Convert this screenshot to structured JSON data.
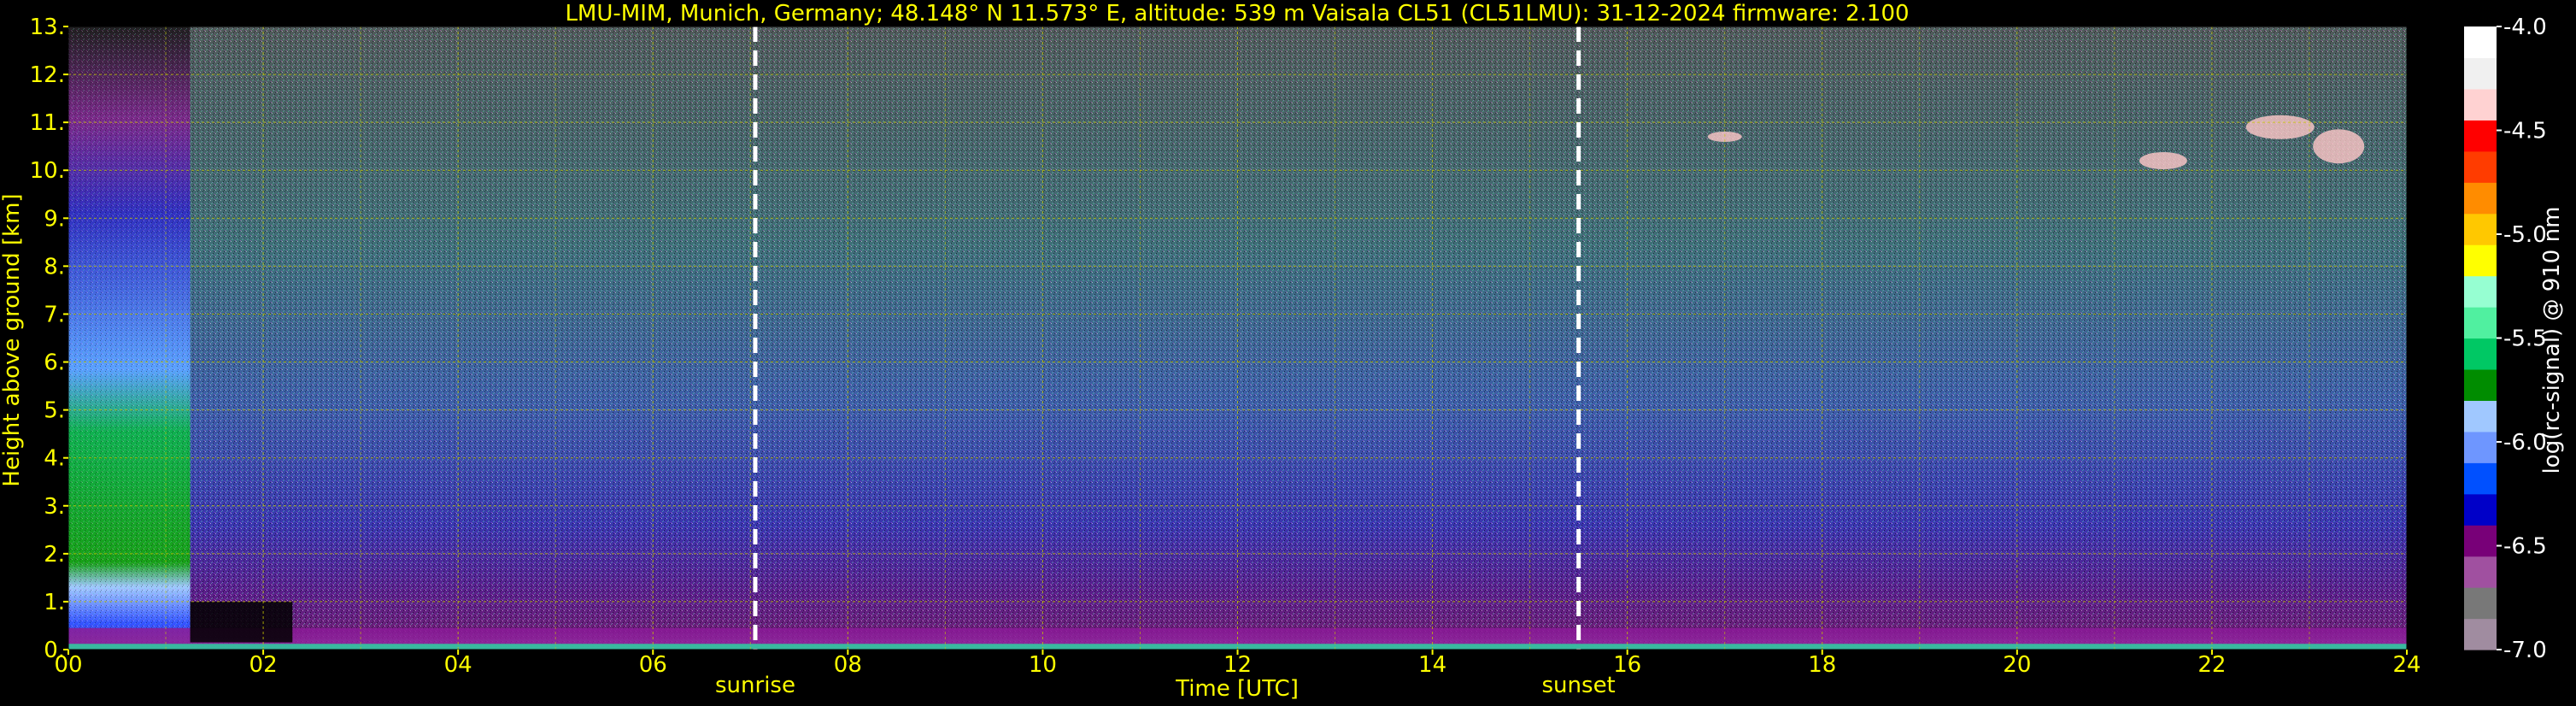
{
  "chart_data": {
    "type": "heatmap",
    "title": "LMU-MIM, Munich, Germany; 48.148° N 11.573° E, altitude: 539 m    Vaisala CL51 (CL51LMU): 31-12-2024    firmware: 2.100",
    "xlabel": "Time [UTC]",
    "ylabel": "Height above ground [km]",
    "colorbar_label": "log(rc-signal) @ 910 nm",
    "xlim": [
      0,
      24
    ],
    "ylim": [
      0,
      13
    ],
    "clim": [
      -7.0,
      -4.0
    ],
    "x_ticks": [
      0,
      2,
      4,
      6,
      8,
      10,
      12,
      14,
      16,
      18,
      20,
      22,
      24
    ],
    "x_tick_labels": [
      "00",
      "02",
      "04",
      "06",
      "08",
      "10",
      "12",
      "14",
      "16",
      "18",
      "20",
      "22",
      "24"
    ],
    "y_ticks": [
      0,
      1,
      2,
      3,
      4,
      5,
      6,
      7,
      8,
      9,
      10,
      11,
      12,
      13
    ],
    "y_tick_labels": [
      "0.",
      "1.",
      "2.",
      "3.",
      "4.",
      "5.",
      "6.",
      "7.",
      "8.",
      "9.",
      "10.",
      "11.",
      "12.",
      "13."
    ],
    "colorbar_ticks": [
      -4.0,
      -4.5,
      -5.0,
      -5.5,
      -6.0,
      -6.5,
      -7.0
    ],
    "colorbar_tick_labels": [
      "-4.0",
      "-4.5",
      "-5.0",
      "-5.5",
      "-6.0",
      "-6.5",
      "-7.0"
    ],
    "grid": true,
    "markers": [
      {
        "label": "sunrise",
        "x": 7.05
      },
      {
        "label": "sunset",
        "x": 15.5
      }
    ]
  },
  "colors": {
    "background": "#000000",
    "text": "#ffff00",
    "grid": "#c8c800",
    "colorbar_text": "#ffffff",
    "marker_line": "#ffffff"
  },
  "colormap": [
    "#a08ca0",
    "#787878",
    "#a050a0",
    "#780078",
    "#0000c8",
    "#0050ff",
    "#6e96ff",
    "#a0c8ff",
    "#008c00",
    "#00c864",
    "#50f0a0",
    "#96ffd2",
    "#ffff00",
    "#ffc800",
    "#ff8c00",
    "#ff3c00",
    "#ff0000",
    "#ffd2d2",
    "#f0f0f0",
    "#ffffff"
  ]
}
